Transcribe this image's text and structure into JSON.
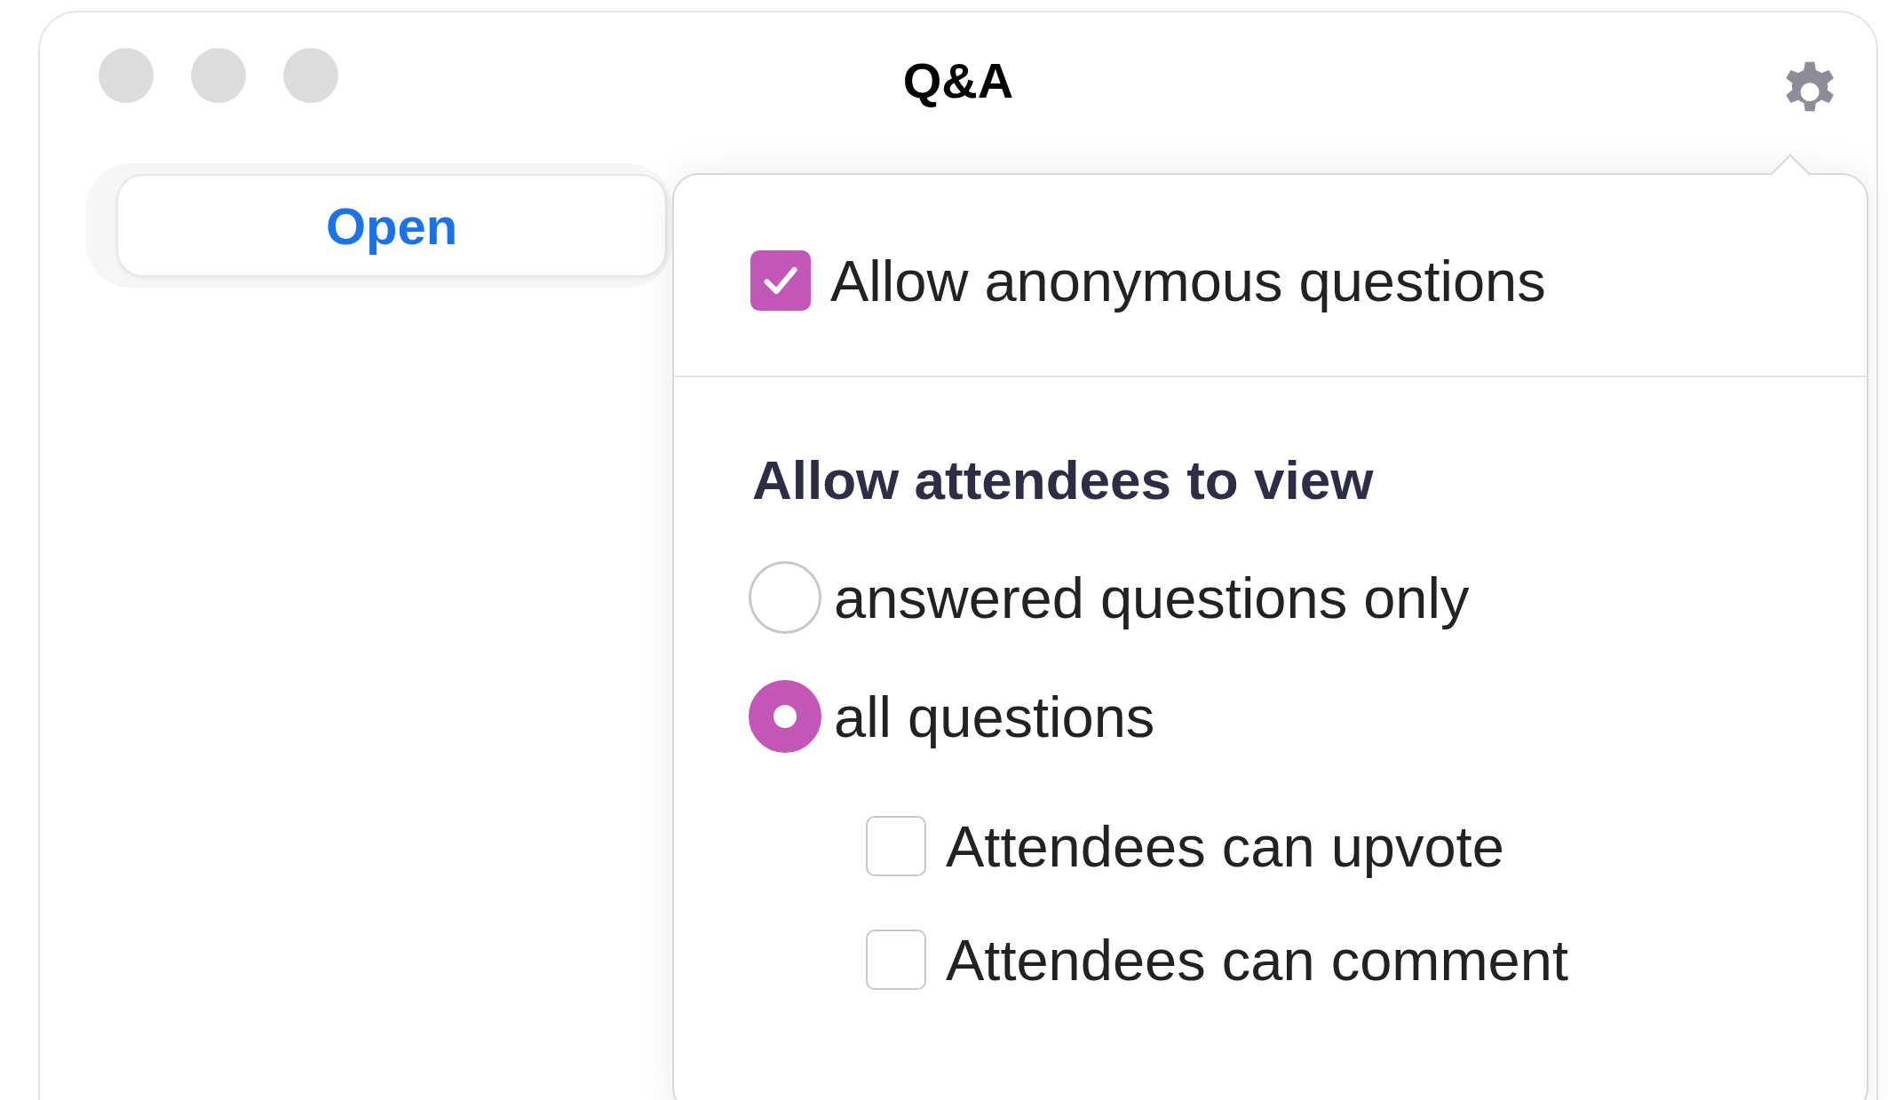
{
  "window": {
    "title": "Q&A"
  },
  "segment": {
    "label": "Open"
  },
  "settings_popover": {
    "anonymous": {
      "label": "Allow anonymous questions",
      "checked": true
    },
    "view_section": {
      "heading": "Allow attendees to view",
      "options": [
        {
          "label": "answered questions only",
          "selected": false
        },
        {
          "label": "all questions",
          "selected": true,
          "children": [
            {
              "label": "Attendees can upvote",
              "checked": false
            },
            {
              "label": "Attendees can comment",
              "checked": false
            }
          ]
        }
      ]
    }
  }
}
